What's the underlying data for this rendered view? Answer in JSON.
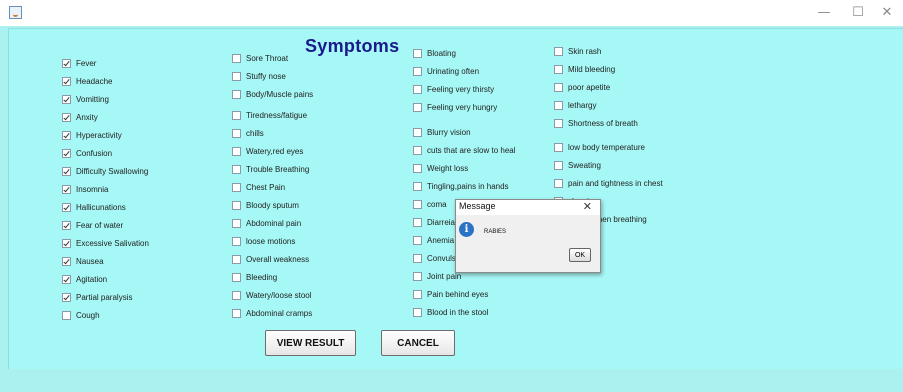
{
  "window": {
    "minimize_glyph": "—",
    "maximize_glyph": "☐",
    "close_glyph": "✕"
  },
  "title": "Symptoms",
  "columns": [
    [
      {
        "label": "Fever",
        "checked": true
      },
      {
        "label": "Headache",
        "checked": true
      },
      {
        "label": "Vomitting",
        "checked": true
      },
      {
        "label": "Anxity",
        "checked": true
      },
      {
        "label": "Hyperactivity",
        "checked": true
      },
      {
        "label": "Confusion",
        "checked": true
      },
      {
        "label": "Difficulty Swallowing",
        "checked": true
      },
      {
        "label": "Insomnia",
        "checked": true
      },
      {
        "label": "Hallicunations",
        "checked": true
      },
      {
        "label": "Fear of water",
        "checked": true
      },
      {
        "label": "Excessive Salivation",
        "checked": true
      },
      {
        "label": "Nausea",
        "checked": true
      },
      {
        "label": "Agitation",
        "checked": true
      },
      {
        "label": "Partial paralysis",
        "checked": true
      },
      {
        "label": "Cough",
        "checked": false
      }
    ],
    [
      {
        "label": "Sore Throat",
        "checked": false
      },
      {
        "label": "Stuffy nose",
        "checked": false
      },
      {
        "label": "Body/Muscle pains",
        "checked": false
      },
      {
        "label": "Tiredness/fatigue",
        "checked": false
      },
      {
        "label": "chills",
        "checked": false
      },
      {
        "label": "Watery,red eyes",
        "checked": false
      },
      {
        "label": "Trouble Breathing",
        "checked": false
      },
      {
        "label": "Chest Pain",
        "checked": false
      },
      {
        "label": "Bloody sputum",
        "checked": false
      },
      {
        "label": "Abdominal pain",
        "checked": false
      },
      {
        "label": "loose motions",
        "checked": false
      },
      {
        "label": "Overall weakness",
        "checked": false
      },
      {
        "label": "Bleeding",
        "checked": false
      },
      {
        "label": "Watery/loose stool",
        "checked": false
      },
      {
        "label": "Abdominal cramps",
        "checked": false
      }
    ],
    [
      {
        "label": "Bloating",
        "checked": false
      },
      {
        "label": "Urinating often",
        "checked": false
      },
      {
        "label": "Feeling very thirsty",
        "checked": false
      },
      {
        "label": "Feeling very hungry",
        "checked": false
      },
      {
        "label": "Blurry vision",
        "checked": false
      },
      {
        "label": "cuts that are slow to heal",
        "checked": false
      },
      {
        "label": "Weight loss",
        "checked": false
      },
      {
        "label": "Tingling,pains in hands",
        "checked": false
      },
      {
        "label": "coma",
        "checked": false
      },
      {
        "label": "Diarreia",
        "checked": false
      },
      {
        "label": "Anemia",
        "checked": false
      },
      {
        "label": "Convulsi",
        "checked": false
      },
      {
        "label": "Joint pain",
        "checked": false
      },
      {
        "label": "Pain behind eyes",
        "checked": false
      },
      {
        "label": "Blood in the stool",
        "checked": false
      }
    ],
    [
      {
        "label": "Skin rash",
        "checked": false
      },
      {
        "label": "Mild bleeding",
        "checked": false
      },
      {
        "label": "poor apetite",
        "checked": false
      },
      {
        "label": "lethargy",
        "checked": false
      },
      {
        "label": "Shortness of breath",
        "checked": false
      },
      {
        "label": "low body temperature",
        "checked": false
      },
      {
        "label": "Sweating",
        "checked": false
      },
      {
        "label": "pain and tightness in chest",
        "checked": false
      },
      {
        "label": "sleeping",
        "checked": false
      },
      {
        "label": "sound when breathing",
        "checked": false
      }
    ]
  ],
  "buttons": {
    "view_result": "VIEW RESULT",
    "cancel": "CANCEL"
  },
  "dialog": {
    "title": "Message",
    "close_glyph": "✕",
    "icon_glyph": "i",
    "message": "RABIES",
    "ok": "OK"
  }
}
